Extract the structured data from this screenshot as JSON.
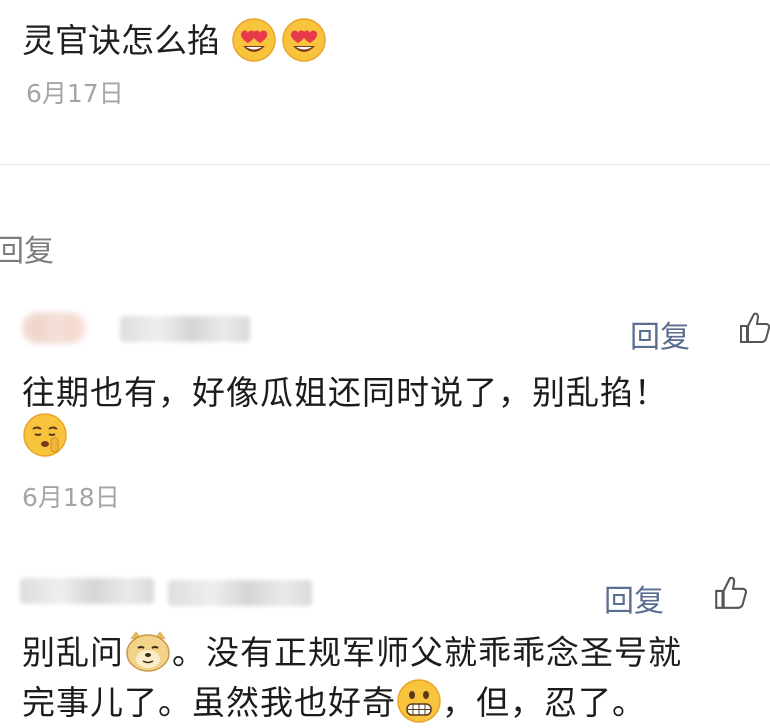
{
  "top_comment": {
    "text_prefix": "灵官诀怎么掐",
    "date": "6月17日"
  },
  "section_label": "回复",
  "replies": [
    {
      "text": "往期也有，好像瓜姐还同时说了，别乱掐！",
      "date": "6月18日",
      "reply_label": "回复"
    },
    {
      "text_line1": "别乱问",
      "text_line1_rest": "。没有正规军师父就乖乖念圣号就",
      "text_line2": "完事儿了。虽然我也好奇",
      "text_line2_rest": "，但，忍了。",
      "reply_label": "回复"
    }
  ],
  "icons": {
    "heart_eyes": "smiling-face-heart-eyes-icon",
    "shush": "shushing-face-icon",
    "doge": "doge-face-icon",
    "grin": "grimacing-face-icon",
    "like": "thumbs-up-icon"
  }
}
